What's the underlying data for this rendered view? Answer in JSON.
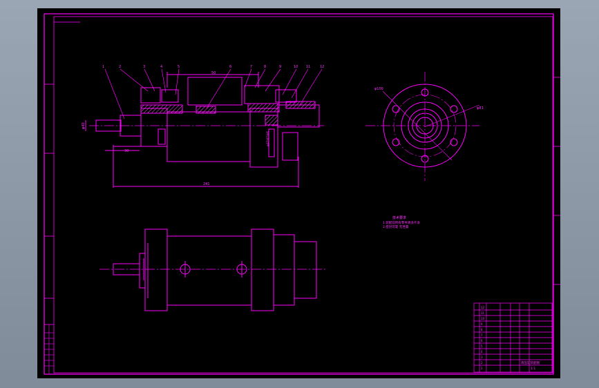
{
  "colors": {
    "background": "#7f8b99",
    "sheet": "#000000",
    "line": "#ff00ff",
    "hatch": "#ff55ff"
  },
  "drawing": {
    "balloons": [
      "1",
      "2",
      "3",
      "4",
      "5",
      "6",
      "7",
      "8",
      "9",
      "10",
      "11",
      "12"
    ],
    "dims": {
      "top_width": "50",
      "left_height": "φ40",
      "shaft_len": "30",
      "overall": "241",
      "phi_100": "φ100",
      "phi_83": "φ83",
      "fit_label": "φ42H7/k6"
    },
    "notes": [
      "技术要求",
      "1.装配前所有零件清洗干净",
      "2.密封可靠 无泄漏"
    ],
    "title_block": {
      "rows": [
        "12",
        "11",
        "10",
        "9",
        "8",
        "7",
        "6",
        "5",
        "4",
        "3",
        "2",
        "1"
      ],
      "drawing_name": "液压缸装配图",
      "scale": "1:1"
    }
  }
}
